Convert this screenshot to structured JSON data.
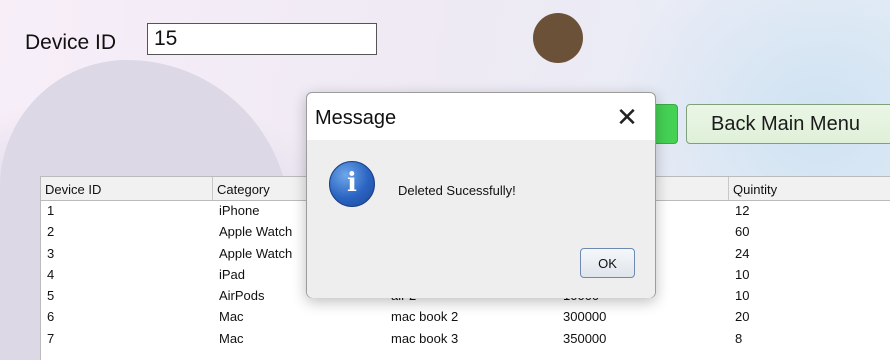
{
  "form": {
    "device_id_label": "Device ID",
    "device_id_value": "15"
  },
  "buttons": {
    "back_label": "Back Main Menu"
  },
  "table": {
    "columns": [
      "Device ID",
      "Category",
      "",
      "",
      "Quintity"
    ],
    "rows": [
      [
        "1",
        "iPhone",
        "",
        "",
        "12"
      ],
      [
        "2",
        "Apple Watch",
        "",
        "",
        "60"
      ],
      [
        "3",
        "Apple Watch",
        "",
        "",
        "24"
      ],
      [
        "4",
        "iPad",
        "",
        "",
        "10"
      ],
      [
        "5",
        "AirPods",
        "air 2",
        "10000",
        "10"
      ],
      [
        "6",
        "Mac",
        "mac book 2",
        "300000",
        "20"
      ],
      [
        "7",
        "Mac",
        "mac book 3",
        "350000",
        "8"
      ]
    ]
  },
  "dialog": {
    "title": "Message",
    "close_glyph": "✕",
    "icon": "info-icon",
    "icon_glyph": "i",
    "message": "Deleted Sucessfully!",
    "ok_label": "OK"
  }
}
